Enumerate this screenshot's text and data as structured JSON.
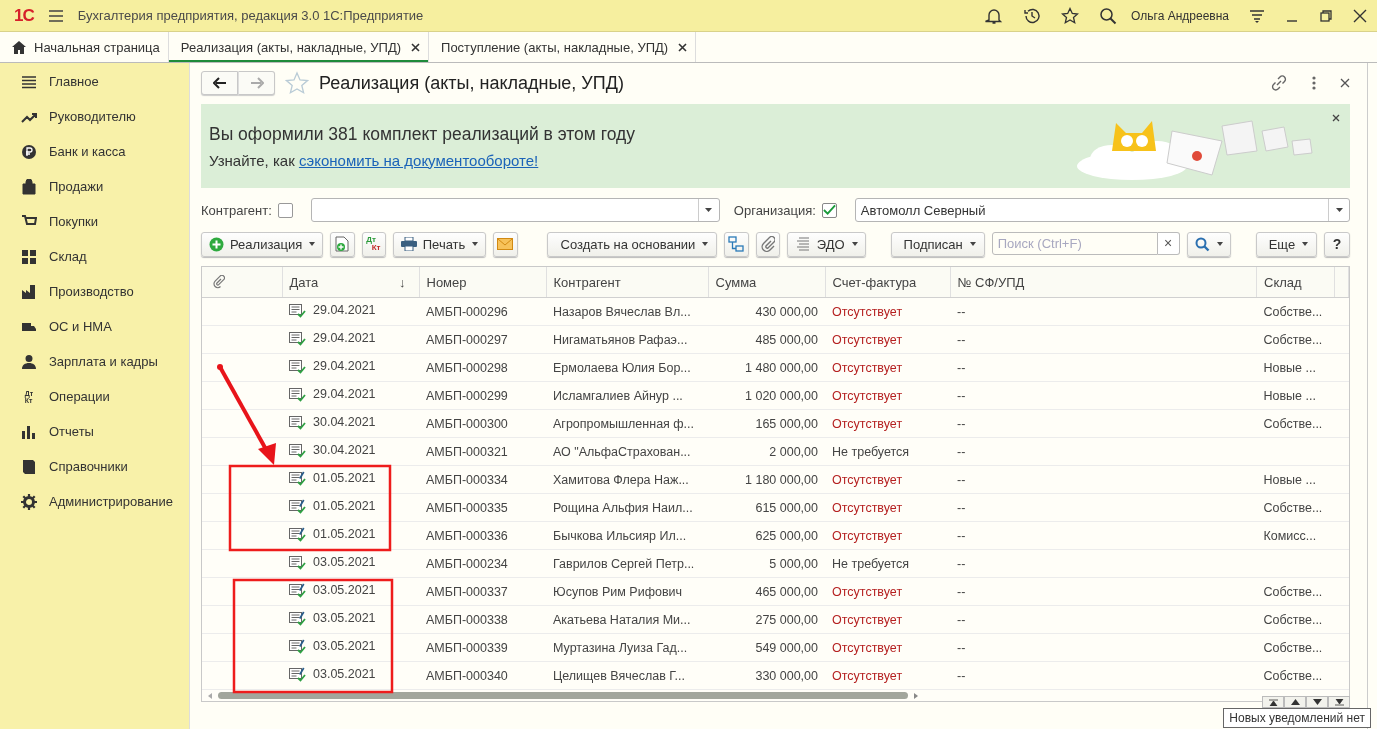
{
  "window": {
    "logo": "1С",
    "app_title": "Бухгалтерия предприятия, редакция 3.0 1С:Предприятие",
    "user": "Ольга Андреевна"
  },
  "tabs": [
    {
      "label": "Начальная страница",
      "selected": false,
      "kind": "home"
    },
    {
      "label": "Реализация (акты, накладные, УПД)",
      "selected": true,
      "kind": "closable"
    },
    {
      "label": "Поступление (акты, накладные, УПД)",
      "selected": false,
      "kind": "closable"
    }
  ],
  "sidebar": {
    "items": [
      {
        "label": "Главное"
      },
      {
        "label": "Руководителю"
      },
      {
        "label": "Банк и касса"
      },
      {
        "label": "Продажи"
      },
      {
        "label": "Покупки"
      },
      {
        "label": "Склад"
      },
      {
        "label": "Производство"
      },
      {
        "label": "ОС и НМА"
      },
      {
        "label": "Зарплата и кадры"
      },
      {
        "label": "Операции",
        "icon_text": [
          "Дт",
          "Кт"
        ]
      },
      {
        "label": "Отчеты"
      },
      {
        "label": "Справочники"
      },
      {
        "label": "Администрирование"
      }
    ]
  },
  "form": {
    "title": "Реализация (акты, накладные, УПД)",
    "favorite": false
  },
  "banner": {
    "headline": "Вы оформили 381 комплект реализаций в этом году",
    "text": "Узнайте, как ",
    "link": "сэкономить на документообороте!"
  },
  "filters": {
    "counterparty": {
      "label": "Контрагент:",
      "checked": false
    },
    "organization": {
      "label": "Организация:",
      "checked": true,
      "value": "Автомолл Северный"
    }
  },
  "toolbar": {
    "create": "Реализация",
    "entries_icon": [
      "Дт",
      "Кт"
    ],
    "print": "Печать",
    "based_on": "Создать на основании",
    "edo": "ЭДО",
    "signed": "Подписан",
    "search_placeholder": "Поиск (Ctrl+F)",
    "search_clear": "×",
    "more": "Еще",
    "help": "?"
  },
  "table": {
    "columns": [
      {
        "label": "Дата",
        "sort_mark": "↓"
      },
      {
        "label": "Номер"
      },
      {
        "label": "Контрагент"
      },
      {
        "label": "Сумма"
      },
      {
        "label": "Счет-фактура"
      },
      {
        "label": "№ СФ/УПД"
      },
      {
        "label": "Склад"
      }
    ],
    "rows": [
      {
        "kind": "posted",
        "date": "29.04.2021",
        "number": "АМБП-000296",
        "counterparty": "Назаров Вячеслав Вл...",
        "sum": "430 000,00",
        "invoice": "Отсутствует",
        "invoice_missing": true,
        "invoice_no": "--",
        "warehouse": "Собстве..."
      },
      {
        "kind": "posted",
        "date": "29.04.2021",
        "number": "АМБП-000297",
        "counterparty": "Нигаматьянов Рафаэ...",
        "sum": "485 000,00",
        "invoice": "Отсутствует",
        "invoice_missing": true,
        "invoice_no": "--",
        "warehouse": "Собстве..."
      },
      {
        "kind": "posted",
        "date": "29.04.2021",
        "number": "АМБП-000298",
        "counterparty": "Ермолаева Юлия Бор...",
        "sum": "1 480 000,00",
        "invoice": "Отсутствует",
        "invoice_missing": true,
        "invoice_no": "--",
        "warehouse": "Новые ..."
      },
      {
        "kind": "posted",
        "date": "29.04.2021",
        "number": "АМБП-000299",
        "counterparty": "Исламгалиев Айнур ...",
        "sum": "1 020 000,00",
        "invoice": "Отсутствует",
        "invoice_missing": true,
        "invoice_no": "--",
        "warehouse": "Новые ..."
      },
      {
        "kind": "posted",
        "date": "30.04.2021",
        "number": "АМБП-000300",
        "counterparty": "Агропромышленная ф...",
        "sum": "165 000,00",
        "invoice": "Отсутствует",
        "invoice_missing": true,
        "invoice_no": "--",
        "warehouse": "Собстве..."
      },
      {
        "kind": "posted",
        "date": "30.04.2021",
        "number": "АМБП-000321",
        "counterparty": "АО \"АльфаСтрахован...",
        "sum": "2 000,00",
        "invoice": "Не требуется",
        "invoice_missing": false,
        "invoice_no": "--"
      },
      {
        "kind": "signed",
        "date": "01.05.2021",
        "number": "АМБП-000334",
        "counterparty": "Хамитова Флера Наж...",
        "sum": "1 180 000,00",
        "invoice": "Отсутствует",
        "invoice_missing": true,
        "invoice_no": "--",
        "warehouse": "Новые ..."
      },
      {
        "kind": "signed",
        "date": "01.05.2021",
        "number": "АМБП-000335",
        "counterparty": "Рощина Альфия Наил...",
        "sum": "615 000,00",
        "invoice": "Отсутствует",
        "invoice_missing": true,
        "invoice_no": "--",
        "warehouse": "Собстве..."
      },
      {
        "kind": "signed",
        "date": "01.05.2021",
        "number": "АМБП-000336",
        "counterparty": "Бычкова Ильсияр Ил...",
        "sum": "625 000,00",
        "invoice": "Отсутствует",
        "invoice_missing": true,
        "invoice_no": "--",
        "warehouse": "Комисс..."
      },
      {
        "kind": "posted",
        "date": "03.05.2021",
        "number": "АМБП-000234",
        "counterparty": "Гаврилов Сергей Петр...",
        "sum": "5 000,00",
        "invoice": "Не требуется",
        "invoice_missing": false,
        "invoice_no": "--"
      },
      {
        "kind": "signed",
        "date": "03.05.2021",
        "number": "АМБП-000337",
        "counterparty": "Юсупов Рим Рифович",
        "sum": "465 000,00",
        "invoice": "Отсутствует",
        "invoice_missing": true,
        "invoice_no": "--",
        "warehouse": "Собстве..."
      },
      {
        "kind": "signed",
        "date": "03.05.2021",
        "number": "АМБП-000338",
        "counterparty": "Акатьева Наталия Ми...",
        "sum": "275 000,00",
        "invoice": "Отсутствует",
        "invoice_missing": true,
        "invoice_no": "--",
        "warehouse": "Собстве..."
      },
      {
        "kind": "signed",
        "date": "03.05.2021",
        "number": "АМБП-000339",
        "counterparty": "Муртазина Луиза Гад...",
        "sum": "549 000,00",
        "invoice": "Отсутствует",
        "invoice_missing": true,
        "invoice_no": "--",
        "warehouse": "Собстве..."
      },
      {
        "kind": "signed",
        "date": "03.05.2021",
        "number": "АМБП-000340",
        "counterparty": "Целищев Вячеслав Г...",
        "sum": "330 000,00",
        "invoice": "Отсутствует",
        "invoice_missing": true,
        "invoice_no": "--",
        "warehouse": "Собстве..."
      }
    ]
  },
  "notification": "Новых уведомлений нет"
}
